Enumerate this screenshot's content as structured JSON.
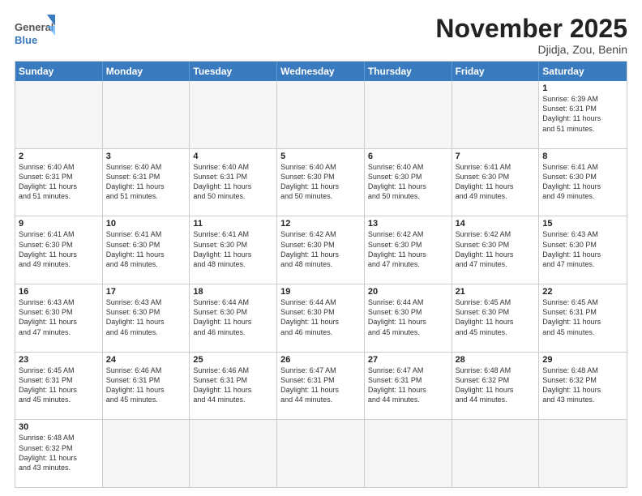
{
  "header": {
    "logo_general": "General",
    "logo_blue": "Blue",
    "month_title": "November 2025",
    "location": "Djidja, Zou, Benin"
  },
  "days_of_week": [
    "Sunday",
    "Monday",
    "Tuesday",
    "Wednesday",
    "Thursday",
    "Friday",
    "Saturday"
  ],
  "weeks": [
    [
      {
        "day": "",
        "info": ""
      },
      {
        "day": "",
        "info": ""
      },
      {
        "day": "",
        "info": ""
      },
      {
        "day": "",
        "info": ""
      },
      {
        "day": "",
        "info": ""
      },
      {
        "day": "",
        "info": ""
      },
      {
        "day": "1",
        "info": "Sunrise: 6:39 AM\nSunset: 6:31 PM\nDaylight: 11 hours\nand 51 minutes."
      }
    ],
    [
      {
        "day": "2",
        "info": "Sunrise: 6:40 AM\nSunset: 6:31 PM\nDaylight: 11 hours\nand 51 minutes."
      },
      {
        "day": "3",
        "info": "Sunrise: 6:40 AM\nSunset: 6:31 PM\nDaylight: 11 hours\nand 51 minutes."
      },
      {
        "day": "4",
        "info": "Sunrise: 6:40 AM\nSunset: 6:31 PM\nDaylight: 11 hours\nand 50 minutes."
      },
      {
        "day": "5",
        "info": "Sunrise: 6:40 AM\nSunset: 6:30 PM\nDaylight: 11 hours\nand 50 minutes."
      },
      {
        "day": "6",
        "info": "Sunrise: 6:40 AM\nSunset: 6:30 PM\nDaylight: 11 hours\nand 50 minutes."
      },
      {
        "day": "7",
        "info": "Sunrise: 6:41 AM\nSunset: 6:30 PM\nDaylight: 11 hours\nand 49 minutes."
      },
      {
        "day": "8",
        "info": "Sunrise: 6:41 AM\nSunset: 6:30 PM\nDaylight: 11 hours\nand 49 minutes."
      }
    ],
    [
      {
        "day": "9",
        "info": "Sunrise: 6:41 AM\nSunset: 6:30 PM\nDaylight: 11 hours\nand 49 minutes."
      },
      {
        "day": "10",
        "info": "Sunrise: 6:41 AM\nSunset: 6:30 PM\nDaylight: 11 hours\nand 48 minutes."
      },
      {
        "day": "11",
        "info": "Sunrise: 6:41 AM\nSunset: 6:30 PM\nDaylight: 11 hours\nand 48 minutes."
      },
      {
        "day": "12",
        "info": "Sunrise: 6:42 AM\nSunset: 6:30 PM\nDaylight: 11 hours\nand 48 minutes."
      },
      {
        "day": "13",
        "info": "Sunrise: 6:42 AM\nSunset: 6:30 PM\nDaylight: 11 hours\nand 47 minutes."
      },
      {
        "day": "14",
        "info": "Sunrise: 6:42 AM\nSunset: 6:30 PM\nDaylight: 11 hours\nand 47 minutes."
      },
      {
        "day": "15",
        "info": "Sunrise: 6:43 AM\nSunset: 6:30 PM\nDaylight: 11 hours\nand 47 minutes."
      }
    ],
    [
      {
        "day": "16",
        "info": "Sunrise: 6:43 AM\nSunset: 6:30 PM\nDaylight: 11 hours\nand 47 minutes."
      },
      {
        "day": "17",
        "info": "Sunrise: 6:43 AM\nSunset: 6:30 PM\nDaylight: 11 hours\nand 46 minutes."
      },
      {
        "day": "18",
        "info": "Sunrise: 6:44 AM\nSunset: 6:30 PM\nDaylight: 11 hours\nand 46 minutes."
      },
      {
        "day": "19",
        "info": "Sunrise: 6:44 AM\nSunset: 6:30 PM\nDaylight: 11 hours\nand 46 minutes."
      },
      {
        "day": "20",
        "info": "Sunrise: 6:44 AM\nSunset: 6:30 PM\nDaylight: 11 hours\nand 45 minutes."
      },
      {
        "day": "21",
        "info": "Sunrise: 6:45 AM\nSunset: 6:30 PM\nDaylight: 11 hours\nand 45 minutes."
      },
      {
        "day": "22",
        "info": "Sunrise: 6:45 AM\nSunset: 6:31 PM\nDaylight: 11 hours\nand 45 minutes."
      }
    ],
    [
      {
        "day": "23",
        "info": "Sunrise: 6:45 AM\nSunset: 6:31 PM\nDaylight: 11 hours\nand 45 minutes."
      },
      {
        "day": "24",
        "info": "Sunrise: 6:46 AM\nSunset: 6:31 PM\nDaylight: 11 hours\nand 45 minutes."
      },
      {
        "day": "25",
        "info": "Sunrise: 6:46 AM\nSunset: 6:31 PM\nDaylight: 11 hours\nand 44 minutes."
      },
      {
        "day": "26",
        "info": "Sunrise: 6:47 AM\nSunset: 6:31 PM\nDaylight: 11 hours\nand 44 minutes."
      },
      {
        "day": "27",
        "info": "Sunrise: 6:47 AM\nSunset: 6:31 PM\nDaylight: 11 hours\nand 44 minutes."
      },
      {
        "day": "28",
        "info": "Sunrise: 6:48 AM\nSunset: 6:32 PM\nDaylight: 11 hours\nand 44 minutes."
      },
      {
        "day": "29",
        "info": "Sunrise: 6:48 AM\nSunset: 6:32 PM\nDaylight: 11 hours\nand 43 minutes."
      }
    ],
    [
      {
        "day": "30",
        "info": "Sunrise: 6:48 AM\nSunset: 6:32 PM\nDaylight: 11 hours\nand 43 minutes."
      },
      {
        "day": "",
        "info": ""
      },
      {
        "day": "",
        "info": ""
      },
      {
        "day": "",
        "info": ""
      },
      {
        "day": "",
        "info": ""
      },
      {
        "day": "",
        "info": ""
      },
      {
        "day": "",
        "info": ""
      }
    ]
  ]
}
